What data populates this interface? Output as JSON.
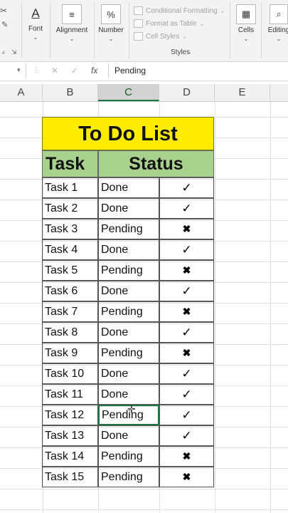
{
  "ribbon": {
    "font_label": "Font",
    "alignment_label": "Alignment",
    "number_label": "Number",
    "number_glyph": "%",
    "conditional_formatting": "Conditional Formatting",
    "format_as_table": "Format as Table",
    "cell_styles": "Cell Styles",
    "styles_group": "Styles",
    "cells_label": "Cells",
    "editing_label": "Editing"
  },
  "formula_bar": {
    "cancel_glyph": "✕",
    "enter_glyph": "✓",
    "fx_glyph": "fx",
    "value": "Pending"
  },
  "columns": [
    "A",
    "B",
    "C",
    "D",
    "E"
  ],
  "active_column": "C",
  "sheet": {
    "title": "To Do List",
    "headers": {
      "task": "Task",
      "status": "Status"
    },
    "rows": [
      {
        "task": "Task 1",
        "status": "Done",
        "mark": "✓"
      },
      {
        "task": "Task 2",
        "status": "Done",
        "mark": "✓"
      },
      {
        "task": "Task 3",
        "status": "Pending",
        "mark": "✖"
      },
      {
        "task": "Task 4",
        "status": "Done",
        "mark": "✓"
      },
      {
        "task": "Task 5",
        "status": "Pending",
        "mark": "✖"
      },
      {
        "task": "Task 6",
        "status": "Done",
        "mark": "✓"
      },
      {
        "task": "Task 7",
        "status": "Pending",
        "mark": "✖"
      },
      {
        "task": "Task 8",
        "status": "Done",
        "mark": "✓"
      },
      {
        "task": "Task 9",
        "status": "Pending",
        "mark": "✖"
      },
      {
        "task": "Task 10",
        "status": "Done",
        "mark": "✓"
      },
      {
        "task": "Task 11",
        "status": "Done",
        "mark": "✓"
      },
      {
        "task": "Task 12",
        "status": "Pending",
        "mark": "✓"
      },
      {
        "task": "Task 13",
        "status": "Done",
        "mark": "✓"
      },
      {
        "task": "Task 14",
        "status": "Pending",
        "mark": "✖"
      },
      {
        "task": "Task 15",
        "status": "Pending",
        "mark": "✖"
      }
    ],
    "selected_row": 11
  },
  "colors": {
    "title_fill": "#ffec00",
    "header_fill": "#a9d18e",
    "selection": "#217346"
  }
}
